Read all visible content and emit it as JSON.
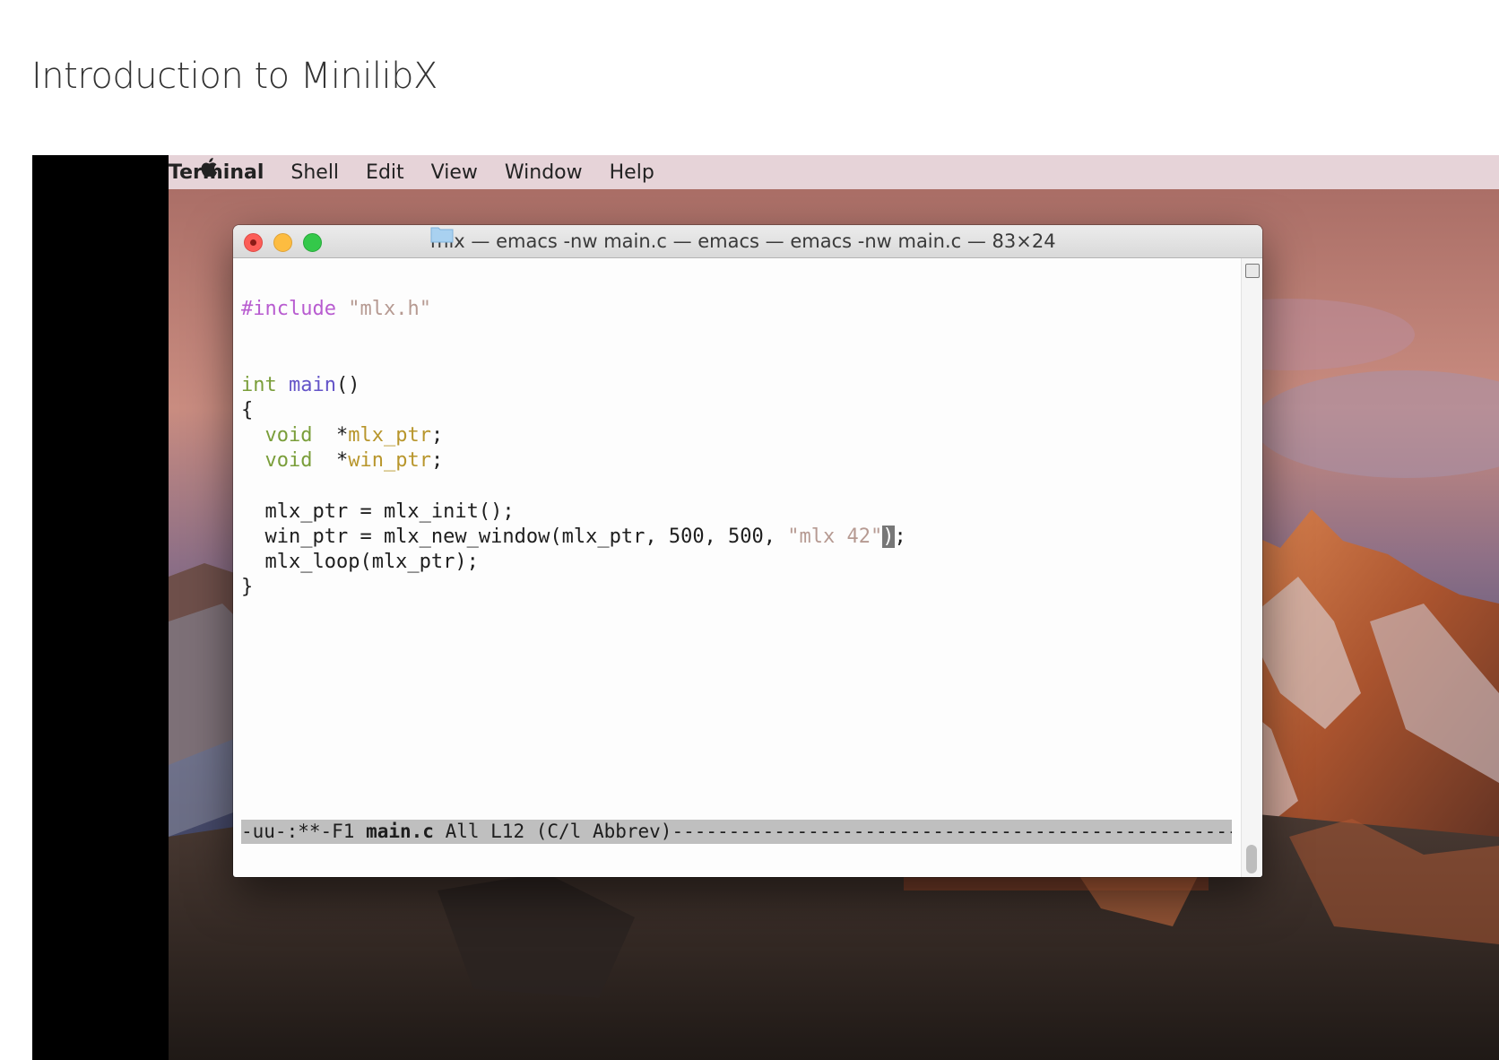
{
  "page": {
    "title": "Introduction to MinilibX"
  },
  "menubar": {
    "apple_icon": "apple-icon",
    "app_name": "Terminal",
    "items": [
      "Shell",
      "Edit",
      "View",
      "Window",
      "Help"
    ]
  },
  "window": {
    "title": "mlx — emacs -nw main.c — emacs — emacs -nw main.c — 83×24",
    "folder_icon": "folder-icon"
  },
  "editor": {
    "lines": [
      [],
      [
        {
          "t": "#include ",
          "c": "pp"
        },
        {
          "t": "\"mlx.h\"",
          "c": "str"
        }
      ],
      [],
      [],
      [
        {
          "t": "int",
          "c": "type"
        },
        {
          "t": " ",
          "c": "plain"
        },
        {
          "t": "main",
          "c": "fn"
        },
        {
          "t": "()",
          "c": "plain"
        }
      ],
      [
        {
          "t": "{",
          "c": "plain"
        }
      ],
      [
        {
          "t": "  ",
          "c": "plain"
        },
        {
          "t": "void",
          "c": "type"
        },
        {
          "t": "  *",
          "c": "plain"
        },
        {
          "t": "mlx_ptr",
          "c": "var"
        },
        {
          "t": ";",
          "c": "plain"
        }
      ],
      [
        {
          "t": "  ",
          "c": "plain"
        },
        {
          "t": "void",
          "c": "type"
        },
        {
          "t": "  *",
          "c": "plain"
        },
        {
          "t": "win_ptr",
          "c": "var"
        },
        {
          "t": ";",
          "c": "plain"
        }
      ],
      [],
      [
        {
          "t": "  mlx_ptr = mlx_init();",
          "c": "plain"
        }
      ],
      [
        {
          "t": "  win_ptr = mlx_new_window(mlx_ptr, 500, 500, ",
          "c": "plain"
        },
        {
          "t": "\"mlx 42\"",
          "c": "str"
        },
        {
          "t": ")",
          "c": "cursor"
        },
        {
          "t": ";",
          "c": "plain"
        }
      ],
      [
        {
          "t": "  mlx_loop(mlx_ptr);",
          "c": "plain"
        }
      ],
      [
        {
          "t": "}",
          "c": "plain"
        }
      ]
    ],
    "modeline": {
      "prefix": "-uu-:**-F1  ",
      "filename": "main.c",
      "middle": "        All L12    (C/l Abbrev)",
      "fill": "--------------------------------------------------"
    }
  },
  "colors": {
    "preprocessor": "#b85cd0",
    "string": "#b69a92",
    "type": "#7a9e3a",
    "function": "#6454c8",
    "variable": "#b8962c",
    "modeline_bg": "#bfbfbf"
  }
}
